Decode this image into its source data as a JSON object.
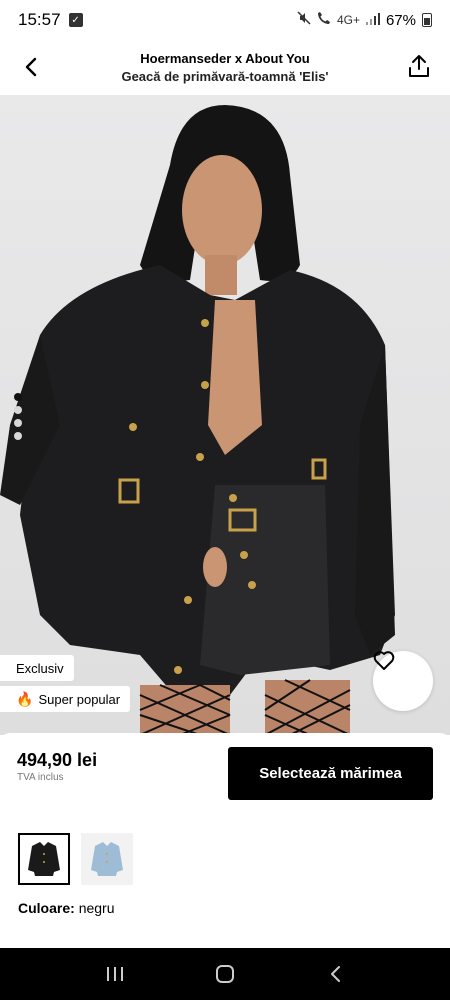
{
  "status": {
    "time": "15:57",
    "network": "4G+",
    "battery": "67%"
  },
  "header": {
    "brand": "Hoermanseder x About You",
    "product_name": "Geacă de primăvară-toamnă 'Elis'"
  },
  "gallery": {
    "image_count": 4,
    "active_index": 0
  },
  "tags": {
    "exclusive": "Exclusiv",
    "popular": "Super popular"
  },
  "purchase": {
    "price": "494,90 lei",
    "vat_note": "TVA inclus",
    "size_button": "Selectează mărimea"
  },
  "color": {
    "label": "Culoare:",
    "value": "negru",
    "swatches": [
      "black denim",
      "light blue denim"
    ]
  },
  "colors": {
    "accent": "#000000",
    "background": "#ffffff",
    "hero_bg": "#e6e6e7"
  }
}
